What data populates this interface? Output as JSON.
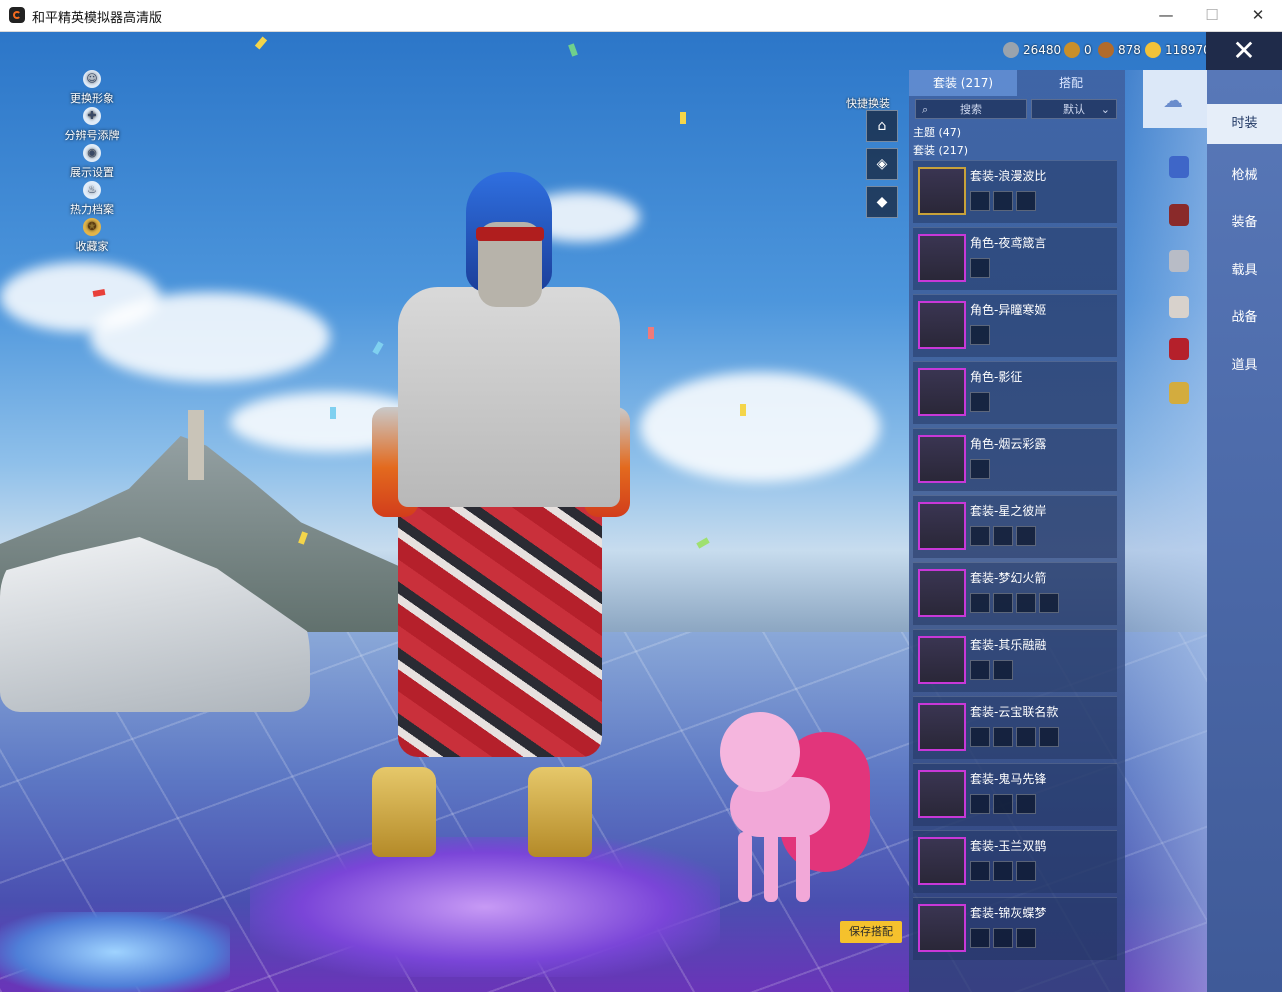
{
  "window": {
    "title": "和平精英模拟器高清版",
    "minimize": "—",
    "maximize": "☐",
    "close": "✕"
  },
  "side_menu": [
    {
      "label": "更换形象",
      "icon": "avatar-icon",
      "glyph": "☺"
    },
    {
      "label": "分辨号添牌",
      "icon": "cross-icon",
      "glyph": "✚"
    },
    {
      "label": "展示设置",
      "icon": "eye-icon",
      "glyph": "◉"
    },
    {
      "label": "热力档案",
      "icon": "flame-icon",
      "glyph": "♨"
    },
    {
      "label": "收藏家",
      "icon": "collector-icon",
      "glyph": "✪"
    }
  ],
  "currencies": [
    {
      "icon": "coin-gray-icon",
      "color": "#9aa3ad",
      "value": "26480"
    },
    {
      "icon": "coin-ring-icon",
      "color": "#c98f2a",
      "value": "0"
    },
    {
      "icon": "coin-bronze-icon",
      "color": "#b26b2a",
      "value": "878"
    },
    {
      "icon": "coin-gold-icon",
      "color": "#f2c23a",
      "value": "118970"
    }
  ],
  "quick_change": {
    "label": "快捷换装",
    "buttons": [
      {
        "icon": "hanger-icon",
        "glyph": "⌂"
      },
      {
        "icon": "badge-icon",
        "glyph": "◈"
      },
      {
        "icon": "diamond-icon",
        "glyph": "◆"
      }
    ]
  },
  "panel": {
    "tabs": [
      {
        "label": "套装 (217)"
      },
      {
        "label": "搭配"
      }
    ],
    "search_placeholder": "搜索",
    "sort_label": "默认",
    "categories": [
      {
        "label": "主题 (47)"
      },
      {
        "label": "套装 (217)"
      }
    ],
    "items": [
      {
        "label": "套装-浪漫波比",
        "slots": 3,
        "frame": "gold"
      },
      {
        "label": "角色-夜鸢箴言",
        "slots": 1,
        "frame": "purple"
      },
      {
        "label": "角色-异瞳寒姬",
        "slots": 1,
        "frame": "purple"
      },
      {
        "label": "角色-影征",
        "slots": 1,
        "frame": "purple"
      },
      {
        "label": "角色-烟云彩露",
        "slots": 1,
        "frame": "purple"
      },
      {
        "label": "套装-星之彼岸",
        "slots": 3,
        "frame": "purple"
      },
      {
        "label": "套装-梦幻火箭",
        "slots": 4,
        "frame": "purple"
      },
      {
        "label": "套装-其乐融融",
        "slots": 2,
        "frame": "purple"
      },
      {
        "label": "套装-云宝联名款",
        "slots": 4,
        "frame": "purple"
      },
      {
        "label": "套装-鬼马先锋",
        "slots": 3,
        "frame": "purple"
      },
      {
        "label": "套装-玉兰双鹊",
        "slots": 3,
        "frame": "purple"
      },
      {
        "label": "套装-锦灰蝶梦",
        "slots": 3,
        "frame": "purple"
      }
    ]
  },
  "category_nav": [
    {
      "label": "时装",
      "active": true
    },
    {
      "label": "枪械",
      "active": false
    },
    {
      "label": "装备",
      "active": false
    },
    {
      "label": "载具",
      "active": false
    },
    {
      "label": "战备",
      "active": false
    },
    {
      "label": "道具",
      "active": false
    }
  ],
  "save_button": "保存搭配",
  "close_game": "✕",
  "colors": {
    "accent": "#f5c12d",
    "panel": "#42609e",
    "nav_active": "#e6eef9"
  }
}
